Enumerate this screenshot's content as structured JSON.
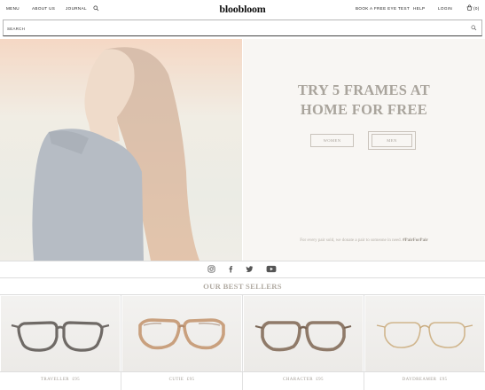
{
  "nav": {
    "menu": "MENU",
    "about": "ABOUT US",
    "journal": "JOURNAL",
    "logo": "bloobloom",
    "eye_test": "BOOK A FREE EYE TEST",
    "help": "HELP",
    "login": "LOGIN",
    "cart_count": "(0)"
  },
  "search": {
    "label": "SEARCH"
  },
  "hero": {
    "title_line1": "TRY 5 FRAMES AT",
    "title_line2": "HOME FOR FREE",
    "cta_women": "WOMEN",
    "cta_men": "MEN",
    "note": "For every pair sold, we donate a pair to someone in need.",
    "note_tag": "#PairForPair"
  },
  "social": [
    "instagram-icon",
    "facebook-icon",
    "twitter-icon",
    "youtube-icon"
  ],
  "bestsellers": {
    "title": "OUR BEST SELLERS",
    "items": [
      {
        "name": "TRAVELLER",
        "price": "£95",
        "frame": "dark-grey"
      },
      {
        "name": "CUTIE",
        "price": "£95",
        "frame": "tortoise"
      },
      {
        "name": "CHARACTER",
        "price": "£95",
        "frame": "tortoise-dark"
      },
      {
        "name": "DAYDREAMER",
        "price": "£95",
        "frame": "gold-wire"
      }
    ]
  },
  "colors": {
    "hero_title": "#a9a49c",
    "hero_bg": "#f8f6f3",
    "accent_text": "#968f86"
  }
}
